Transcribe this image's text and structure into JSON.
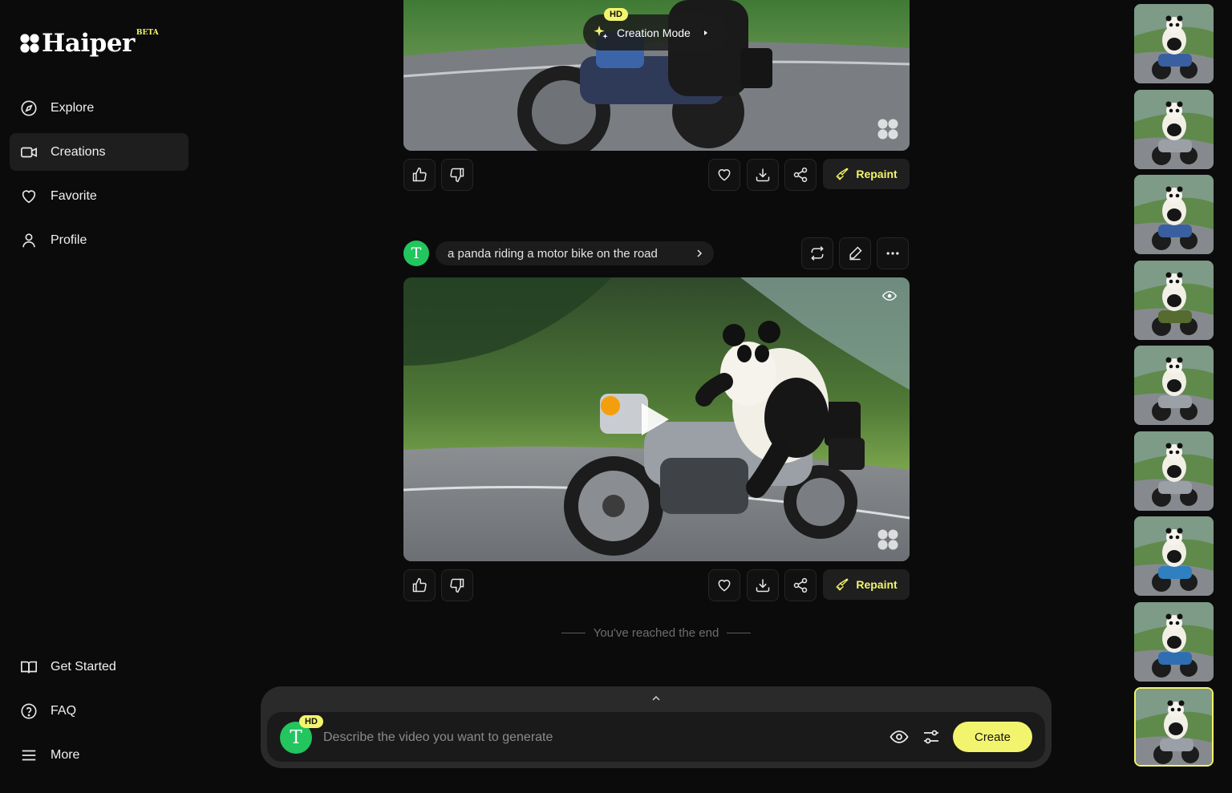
{
  "brand": {
    "name": "Haiper",
    "beta": "BETA"
  },
  "sidebar": {
    "top_items": [
      {
        "label": "Explore",
        "icon": "compass-icon"
      },
      {
        "label": "Creations",
        "icon": "video-camera-icon",
        "active": true
      },
      {
        "label": "Favorite",
        "icon": "heart-icon"
      },
      {
        "label": "Profile",
        "icon": "user-icon"
      }
    ],
    "bottom_items": [
      {
        "label": "Get Started",
        "icon": "book-icon"
      },
      {
        "label": "FAQ",
        "icon": "question-circle-icon"
      },
      {
        "label": "More",
        "icon": "menu-icon"
      }
    ]
  },
  "feed": {
    "top_card": {
      "badge": "HD",
      "mode_label": "Creation Mode",
      "actions": {
        "repaint": "Repaint"
      }
    },
    "main_card": {
      "avatar_letter": "T",
      "prompt": "a panda riding a motor bike on the road",
      "actions": {
        "repaint": "Repaint"
      }
    },
    "end_text": "You've reached the end"
  },
  "composer": {
    "badge": "HD",
    "avatar_letter": "T",
    "placeholder": "Describe the video you want to generate",
    "create_label": "Create"
  },
  "thumbnails": {
    "count": 9,
    "selected_index": 8
  },
  "colors": {
    "accent": "#f3f46d",
    "avatar": "#22c55e",
    "background": "#0b0b0b"
  }
}
